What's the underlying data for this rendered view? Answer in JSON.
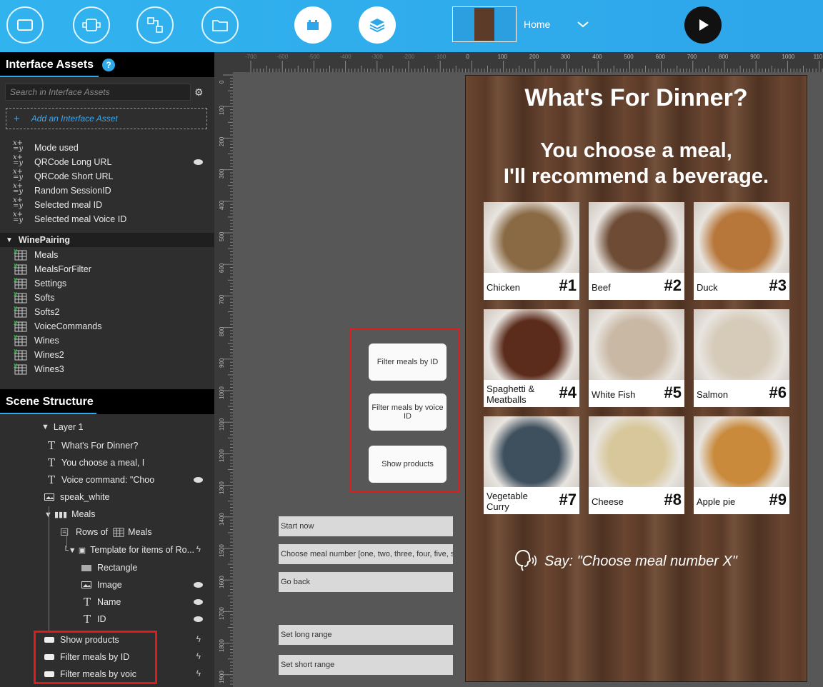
{
  "toolbar": {
    "screen_name": "Home",
    "buttons": [
      "screen-icon",
      "device-icon",
      "flow-icon",
      "folder-icon",
      "brick-icon",
      "layers-icon"
    ],
    "play": "play-icon"
  },
  "assets": {
    "title": "Interface Assets",
    "help": "?",
    "search_placeholder": "Search in Interface Assets",
    "add_label": "Add an Interface Asset",
    "variables": [
      "Mode used",
      "QRCode Long URL",
      "QRCode Short URL",
      "Random SessionID",
      "Selected meal ID",
      "Selected meal Voice ID"
    ],
    "folder": "WinePairing",
    "tables": [
      "Meals",
      "MealsForFilter",
      "Settings",
      "Softs",
      "Softs2",
      "VoiceCommands",
      "Wines",
      "Wines2",
      "Wines3"
    ]
  },
  "scene": {
    "title": "Scene Structure",
    "layer": "Layer 1",
    "items": [
      "What's For Dinner?",
      "You choose a meal, I",
      "Voice command: \"Choo",
      "speak_white",
      "Meals",
      "Rows of",
      "Meals",
      "Template for items of Ro...",
      "Rectangle",
      "Image",
      "Name",
      "ID",
      "Show products",
      "Filter meals by ID",
      "Filter meals by voic"
    ]
  },
  "ruler": {
    "top": [
      "-700",
      "-600",
      "-500",
      "-400",
      "-300",
      "-200",
      "-100",
      "0",
      "100",
      "200",
      "300",
      "400",
      "500",
      "600",
      "700",
      "800",
      "900",
      "1000",
      "110"
    ],
    "left": [
      "0",
      "100",
      "200",
      "300",
      "400",
      "500",
      "600",
      "700",
      "800",
      "900",
      "1000",
      "1100",
      "1200",
      "1300",
      "1400",
      "1500",
      "1600",
      "1700",
      "1800",
      "1900"
    ]
  },
  "offscreen_buttons": [
    "Filter meals by ID",
    "Filter meals by voice ID",
    "Show products"
  ],
  "voice_commands": [
    "Start now",
    "Choose meal number [one, two, three, four, five, s",
    "Go back",
    "Set long range",
    "Set short range"
  ],
  "phone": {
    "title": "What's For Dinner?",
    "sub1": "You choose a meal,",
    "sub2": "I'll recommend a beverage.",
    "meals": [
      {
        "name": "Chicken",
        "id": "#1",
        "color": "#8a6a45"
      },
      {
        "name": "Beef",
        "id": "#2",
        "color": "#6e4b35"
      },
      {
        "name": "Duck",
        "id": "#3",
        "color": "#b8773a"
      },
      {
        "name": "Spaghetti & Meatballs",
        "id": "#4",
        "color": "#5b2c1c"
      },
      {
        "name": "White Fish",
        "id": "#5",
        "color": "#c9b8a4"
      },
      {
        "name": "Salmon",
        "id": "#6",
        "color": "#d6cbb9"
      },
      {
        "name": "Vegetable Curry",
        "id": "#7",
        "color": "#3e4f5e"
      },
      {
        "name": "Cheese",
        "id": "#8",
        "color": "#d8c79a"
      },
      {
        "name": "Apple pie",
        "id": "#9",
        "color": "#c98a3c"
      }
    ],
    "say": "Say: \"Choose meal number X\""
  }
}
